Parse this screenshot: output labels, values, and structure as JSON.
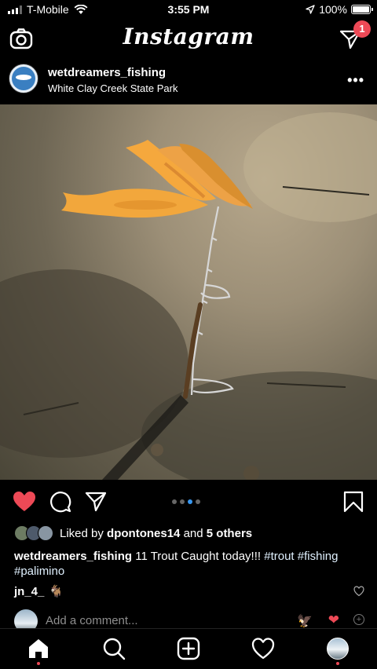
{
  "status_bar": {
    "carrier": "T-Mobile",
    "time": "3:55 PM",
    "battery": "100%"
  },
  "topnav": {
    "logo": "Instagram",
    "dm_badge": "1"
  },
  "post": {
    "username": "wetdreamers_fishing",
    "location": "White Clay Creek State Park",
    "more": "•••",
    "likes_prefix": "Liked by",
    "liked_user": "dpontones14",
    "likes_and": "and",
    "likes_others": "5 others",
    "caption_user": "wetdreamers_fishing",
    "caption_text": "11 Trout Caught today!!!",
    "caption_tags": "#trout #fishing #palimino",
    "comment_user": "jn_4_",
    "comment_text": "🐐",
    "add_comment_placeholder": "Add a comment...",
    "quick_emoji_1": "🦅",
    "quick_emoji_2": "❤",
    "carousel_count": 4,
    "carousel_active": 3
  },
  "colors": {
    "like_red": "#ed4956",
    "carousel_blue": "#3897f0"
  }
}
